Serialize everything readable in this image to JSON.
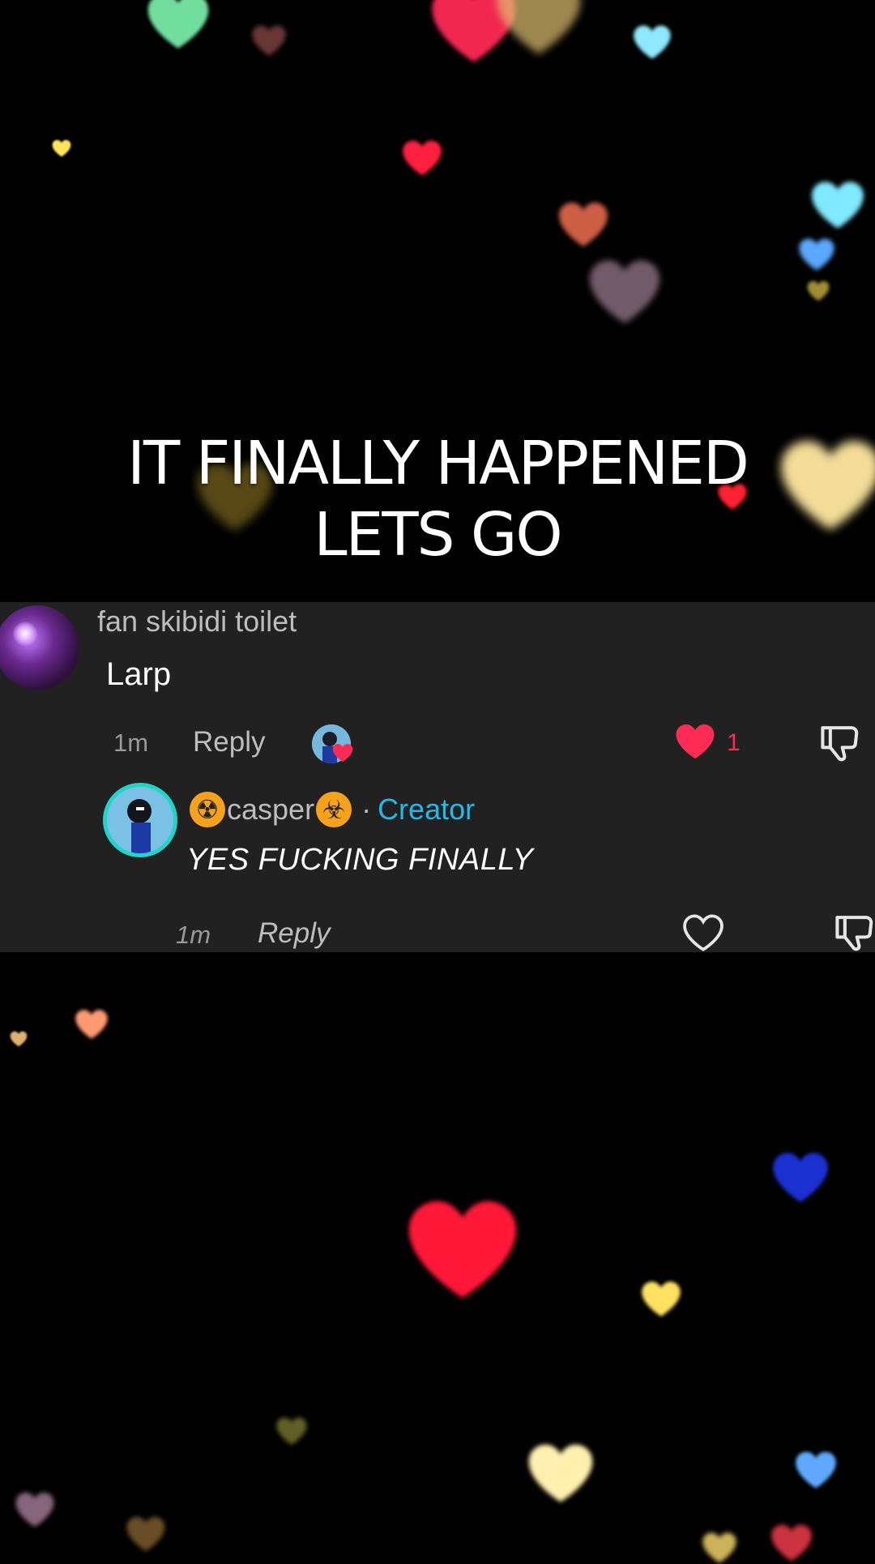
{
  "caption": {
    "line1": "IT FINALLY HAPPENED",
    "line2": "LETS GO"
  },
  "comment": {
    "username": "fan skibidi toilet",
    "text": "Larp",
    "time": "1m",
    "reply_label": "Reply",
    "like_count": "1",
    "liked_by_creator": true,
    "like_color": "#fe2c55"
  },
  "reply": {
    "username": "casper",
    "badge_left": "☢",
    "badge_right": "☣",
    "separator": "·",
    "role_label": "Creator",
    "text": "YES FUCKING FINALLY",
    "time": "1m",
    "reply_label": "Reply",
    "creator_color": "#25b8e6",
    "avatar_ring_color": "#20d5c8"
  },
  "icons": {
    "like": "heart-icon",
    "dislike": "thumbs-down-icon",
    "creator_like": "creator-liked-avatar-icon"
  }
}
